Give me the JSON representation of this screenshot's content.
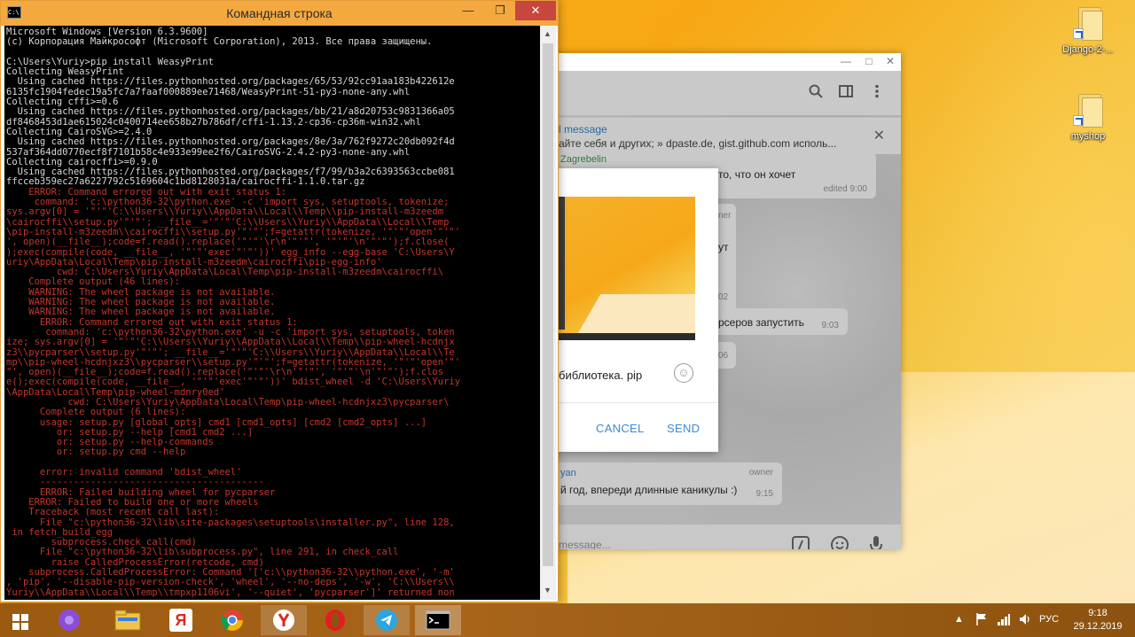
{
  "desktop": {
    "icons": [
      {
        "label": "Django-2-..."
      },
      {
        "label": "myshop"
      }
    ]
  },
  "cmd": {
    "title": "Командная строка",
    "icon_text": "C:\\",
    "lines": [
      {
        "text": "Microsoft Windows [Version 6.3.9600]",
        "color": "white"
      },
      {
        "text": "(с) Корпорация Майкрософт (Microsoft Corporation), 2013. Все права защищены.",
        "color": "white"
      },
      {
        "text": "",
        "color": "white"
      },
      {
        "text": "C:\\Users\\Yuriy>pip install WeasyPrint",
        "color": "white"
      },
      {
        "text": "Collecting WeasyPrint",
        "color": "white"
      },
      {
        "text": "  Using cached https://files.pythonhosted.org/packages/65/53/92cc91aa183b422612e",
        "color": "white"
      },
      {
        "text": "6135fc1904fedec19a5fc7a7faaf000889ee71468/WeasyPrint-51-py3-none-any.whl",
        "color": "white"
      },
      {
        "text": "Collecting cffi>=0.6",
        "color": "white"
      },
      {
        "text": "  Using cached https://files.pythonhosted.org/packages/bb/21/a8d20753c9831366a05",
        "color": "white"
      },
      {
        "text": "df8468453d1ae615024c0400714ee658b27b786df/cffi-1.13.2-cp36-cp36m-win32.whl",
        "color": "white"
      },
      {
        "text": "Collecting CairoSVG>=2.4.0",
        "color": "white"
      },
      {
        "text": "  Using cached https://files.pythonhosted.org/packages/8e/3a/762f9272c20db092f4d",
        "color": "white"
      },
      {
        "text": "537af364dd0770ecf8f7101b58c4e933e99ee2f6/CairoSVG-2.4.2-py3-none-any.whl",
        "color": "white"
      },
      {
        "text": "Collecting cairocffi>=0.9.0",
        "color": "white"
      },
      {
        "text": "  Using cached https://files.pythonhosted.org/packages/f7/99/b3a2c6393563ccbe081",
        "color": "white"
      },
      {
        "text": "ffcceb359ec27a6227792c5169604c1bd8128031a/cairocffi-1.1.0.tar.gz",
        "color": "white"
      },
      {
        "text": "    ERROR: Command errored out with exit status 1:",
        "color": "red"
      },
      {
        "text": "     command: 'c:\\python36-32\\python.exe' -c 'import sys, setuptools, tokenize;",
        "color": "red"
      },
      {
        "text": "sys.argv[0] = '\"'\"'C:\\\\Users\\\\Yuriy\\\\AppData\\\\Local\\\\Temp\\\\pip-install-m3zeedm",
        "color": "red"
      },
      {
        "text": "\\cairocffi\\\\setup.py'\"'\"'; __file__='\"'\"'C:\\\\Users\\\\Yuriy\\\\AppData\\\\Local\\\\Temp",
        "color": "red"
      },
      {
        "text": "\\pip-install-m3zeedm\\\\cairocffi\\\\setup.py'\"'\"';f=getattr(tokenize, '\"'\"'open'\"'\"'",
        "color": "red"
      },
      {
        "text": "', open)(__file__);code=f.read().replace('\"'\"'\\r\\n'\"'\"', '\"'\"'\\n'\"'\"');f.close(",
        "color": "red"
      },
      {
        "text": ");exec(compile(code, __file__, '\"'\"'exec'\"'\"'))' egg_info --egg-base 'C:\\Users\\Y",
        "color": "red"
      },
      {
        "text": "uriy\\AppData\\Local\\Temp\\pip-install-m3zeedm\\cairocffi\\pip-egg-info'",
        "color": "red"
      },
      {
        "text": "         cwd: C:\\Users\\Yuriy\\AppData\\Local\\Temp\\pip-install-m3zeedm\\cairocffi\\",
        "color": "red"
      },
      {
        "text": "    Complete output (46 lines):",
        "color": "red"
      },
      {
        "text": "    WARNING: The wheel package is not available.",
        "color": "red"
      },
      {
        "text": "    WARNING: The wheel package is not available.",
        "color": "red"
      },
      {
        "text": "    WARNING: The wheel package is not available.",
        "color": "red"
      },
      {
        "text": "      ERROR: Command errored out with exit status 1:",
        "color": "red"
      },
      {
        "text": "       command: 'c:\\python36-32\\python.exe' -u -c 'import sys, setuptools, token",
        "color": "red"
      },
      {
        "text": "ize; sys.argv[0] = '\"'\"'C:\\\\Users\\\\Yuriy\\\\AppData\\\\Local\\\\Temp\\\\pip-wheel-hcdnjx",
        "color": "red"
      },
      {
        "text": "z3\\\\pycparser\\\\setup.py'\"'\"'; __file__='\"'\"'C:\\\\Users\\\\Yuriy\\\\AppData\\\\Local\\\\Te",
        "color": "red"
      },
      {
        "text": "mp\\\\pip-wheel-hcdnjxz3\\\\pycparser\\\\setup.py'\"'\"';f=getattr(tokenize, '\"'\"'open'\"'",
        "color": "red"
      },
      {
        "text": "\"', open)(__file__);code=f.read().replace('\"'\"'\\r\\n'\"'\"', '\"'\"'\\n'\"'\"');f.clos",
        "color": "red"
      },
      {
        "text": "e();exec(compile(code, __file__, '\"'\"'exec'\"'\"'))' bdist_wheel -d 'C:\\Users\\Yuriy",
        "color": "red"
      },
      {
        "text": "\\AppData\\Local\\Temp\\pip-wheel-mdnry0ed'",
        "color": "red"
      },
      {
        "text": "           cwd: C:\\Users\\Yuriy\\AppData\\Local\\Temp\\pip-wheel-hcdnjxz3\\pycparser\\",
        "color": "red"
      },
      {
        "text": "      Complete output (6 lines):",
        "color": "red"
      },
      {
        "text": "      usage: setup.py [global_opts] cmd1 [cmd1_opts] [cmd2 [cmd2_opts] ...]",
        "color": "red"
      },
      {
        "text": "         or: setup.py --help [cmd1 cmd2 ...]",
        "color": "red"
      },
      {
        "text": "         or: setup.py --help-commands",
        "color": "red"
      },
      {
        "text": "         or: setup.py cmd --help",
        "color": "red"
      },
      {
        "text": "",
        "color": "red"
      },
      {
        "text": "      error: invalid command 'bdist_wheel'",
        "color": "red"
      },
      {
        "text": "      ----------------------------------------",
        "color": "red"
      },
      {
        "text": "      ERROR: Failed building wheel for pycparser",
        "color": "red"
      },
      {
        "text": "    ERROR: Failed to build one or more wheels",
        "color": "red"
      },
      {
        "text": "    Traceback (most recent call last):",
        "color": "red"
      },
      {
        "text": "      File \"c:\\python36-32\\lib\\site-packages\\setuptools\\installer.py\", line 128,",
        "color": "red"
      },
      {
        "text": " in fetch_build_egg",
        "color": "red"
      },
      {
        "text": "        subprocess.check_call(cmd)",
        "color": "red"
      },
      {
        "text": "      File \"c:\\python36-32\\lib\\subprocess.py\", line 291, in check_call",
        "color": "red"
      },
      {
        "text": "        raise CalledProcessError(retcode, cmd)",
        "color": "red"
      },
      {
        "text": "    subprocess.CalledProcessError: Command '['c:\\\\python36-32\\\\python.exe', '-m'",
        "color": "red"
      },
      {
        "text": ", 'pip', '--disable-pip-version-check', 'wheel', '--no-deps', '-w', 'C:\\\\Users\\\\",
        "color": "red"
      },
      {
        "text": "Yuriy\\\\AppData\\\\Local\\\\Temp\\\\tmpxp1106vi', '--quiet', 'pycparser']' returned non",
        "color": "red"
      }
    ]
  },
  "telegram": {
    "pinned_title": "l message",
    "pinned_text": "айте себя и других; » dpaste.de, gist.github.com исполь...",
    "messages": [
      {
        "sender": "Zagrebelin",
        "text": "то, что он хочет",
        "meta": "edited 9:00"
      },
      {
        "sender": "",
        "text": "ner",
        "meta": ""
      },
      {
        "sender": "",
        "text": "ут",
        "meta": ""
      },
      {
        "sender": "",
        "text": "",
        "meta": "02"
      },
      {
        "sender": "",
        "text": "рсеров запустить",
        "meta": "9:03"
      },
      {
        "sender": "",
        "text": "",
        "meta": "06"
      },
      {
        "sender": "yan",
        "text": "й год, впереди длинные каникулы :)",
        "meta": "9:15",
        "role": "owner"
      }
    ],
    "input_placeholder": "message...",
    "dialog": {
      "caption": "библиотека. pip",
      "cancel": "CANCEL",
      "send": "SEND"
    }
  },
  "taskbar": {
    "language": "РУС",
    "time": "9:18",
    "date": "29.12.2019",
    "yandex_label": "Я"
  },
  "colors": {
    "cmd_red": "#c3362d",
    "cmd_title": "#f4a940",
    "tg_accent": "#3a8bd0",
    "taskbar": "#9a5a10"
  }
}
